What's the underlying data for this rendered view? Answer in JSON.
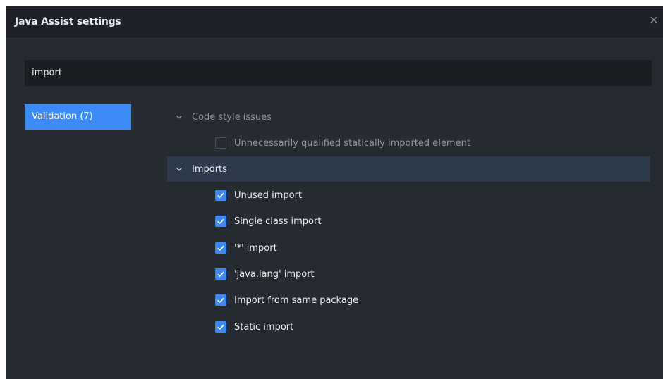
{
  "dialog": {
    "title": "Java Assist settings",
    "close_glyph": "×"
  },
  "search": {
    "value": "import",
    "placeholder": ""
  },
  "nav": {
    "items": [
      {
        "label": "Validation  (7)"
      }
    ]
  },
  "tree": {
    "groups": [
      {
        "label": "Code style issues",
        "items": [
          {
            "label": "Unnecessarily qualified statically imported element",
            "checked": false
          }
        ]
      },
      {
        "label": "Imports",
        "items": [
          {
            "label": "Unused import",
            "checked": true
          },
          {
            "label": "Single class import",
            "checked": true
          },
          {
            "label": "'*' import",
            "checked": true
          },
          {
            "label": "'java.lang' import",
            "checked": true
          },
          {
            "label": "Import from same package",
            "checked": true
          },
          {
            "label": "Static import",
            "checked": true
          }
        ]
      }
    ]
  },
  "colors": {
    "accent": "#3b8af6",
    "background": "#262a31",
    "selected_row": "#2d3a4d"
  },
  "icons": {
    "expand": "chevron-down-icon",
    "check": "checkmark-icon",
    "close": "close-icon"
  }
}
